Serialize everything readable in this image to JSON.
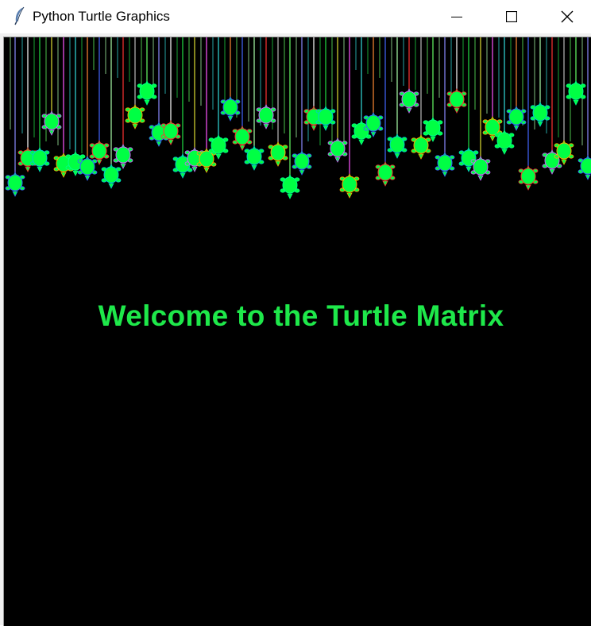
{
  "window": {
    "title": "Python Turtle Graphics",
    "icon": "feather-icon",
    "controls": [
      "minimize-icon",
      "maximize-icon",
      "close-icon"
    ]
  },
  "canvas": {
    "background": "#000000",
    "turtle_color": "#00ff44",
    "banner_text": "Welcome to the Turtle Matrix",
    "banner_color": "#1ee84a"
  }
}
